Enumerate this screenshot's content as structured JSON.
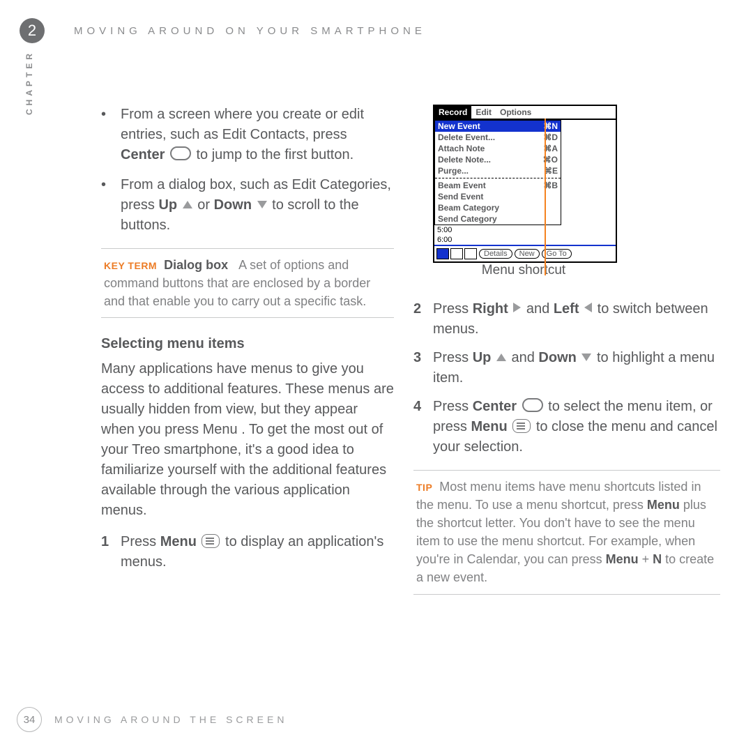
{
  "header": {
    "chapter_number": "2",
    "running_title": "MOVING AROUND ON YOUR SMARTPHONE",
    "chapter_label": "CHAPTER"
  },
  "left_column": {
    "bullets": [
      {
        "pre": "From a screen where you create or edit entries, such as Edit Contacts, press ",
        "bold": "Center",
        "post": " to jump to the first button.",
        "icon": "center"
      },
      {
        "pre": "From a dialog box, such as Edit Categories, press ",
        "bold_up": "Up",
        "mid": " or ",
        "bold_down": "Down",
        "post": " to scroll to the buttons."
      }
    ],
    "keyterm": {
      "label": "KEY TERM",
      "term": "Dialog box",
      "body": "A set of options and command buttons that are enclosed by a border and that enable you to carry out a specific task."
    },
    "subheading": "Selecting menu items",
    "paragraph": "Many applications have menus to give you access to additional features. These menus are usually hidden from view, but they appear when you press Menu       . To get the most out of your Treo smartphone, it's a good idea to familiarize yourself with the additional features available through the various application menus.",
    "step1": {
      "num": "1",
      "pre": "Press ",
      "bold": "Menu",
      "post": " to display an application's menus."
    }
  },
  "right_column": {
    "screenshot": {
      "tabs": [
        "Record",
        "Edit",
        "Options"
      ],
      "menu": [
        {
          "label": "New Event",
          "shortcut": "N",
          "selected": true
        },
        {
          "label": "Delete Event...",
          "shortcut": "D"
        },
        {
          "label": "Attach Note",
          "shortcut": "A"
        },
        {
          "label": "Delete Note...",
          "shortcut": "O"
        },
        {
          "label": "Purge...",
          "shortcut": "E"
        }
      ],
      "menu2": [
        {
          "label": "Beam Event",
          "shortcut": "B"
        },
        {
          "label": "Send Event",
          "shortcut": ""
        },
        {
          "label": "Beam Category",
          "shortcut": ""
        },
        {
          "label": "Send Category",
          "shortcut": ""
        }
      ],
      "hours": [
        "5:00",
        "6:00"
      ],
      "bottom_buttons": [
        "Details",
        "New",
        "Go To"
      ]
    },
    "caption": "Menu shortcut",
    "step2": {
      "num": "2",
      "pre": "Press ",
      "b1": "Right",
      "mid": " and ",
      "b2": "Left",
      "post": " to switch between menus."
    },
    "step3": {
      "num": "3",
      "pre": "Press ",
      "b1": "Up",
      "mid": " and ",
      "b2": "Down",
      "post": " to highlight a menu item."
    },
    "step4": {
      "num": "4",
      "pre": "Press ",
      "b1": "Center",
      "mid": " to select the menu item, or press ",
      "b2": "Menu",
      "post": " to close the menu and cancel your selection."
    },
    "tip": {
      "label": "TIP",
      "body_a": "Most menu items have menu shortcuts listed in the menu. To use a menu shortcut, press ",
      "bold_a": "Menu",
      "body_b": " plus the shortcut letter. You don't have to see the menu item to use the menu shortcut. For example, when you're in Calendar, you can press ",
      "bold_b": "Menu",
      "plus": " + ",
      "bold_c": "N",
      "body_c": " to create a new event."
    }
  },
  "footer": {
    "page": "34",
    "section": "MOVING AROUND THE SCREEN"
  }
}
